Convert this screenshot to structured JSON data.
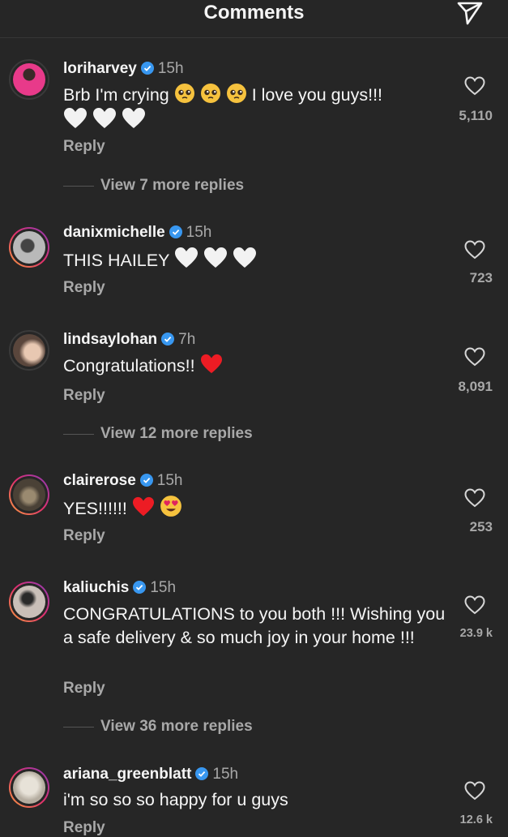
{
  "header": {
    "title": "Comments"
  },
  "comments": [
    {
      "username": "loriharvey",
      "time": "15h",
      "text_before": "Brb I'm crying",
      "text_after": "I love you guys!!!",
      "likes": "5,110",
      "reply": "Reply",
      "view_more": "View 7 more replies"
    },
    {
      "username": "danixmichelle",
      "time": "15h",
      "text": "THIS HAILEY",
      "likes": "723",
      "reply": "Reply"
    },
    {
      "username": "lindsaylohan",
      "time": "7h",
      "text": "Congratulations!!",
      "likes": "8,091",
      "reply": "Reply",
      "view_more": "View 12 more replies"
    },
    {
      "username": "clairerose",
      "time": "15h",
      "text": "YES!!!!!!",
      "likes": "253",
      "reply": "Reply"
    },
    {
      "username": "kaliuchis",
      "time": "15h",
      "text": "CONGRATULATIONS to you both !!! Wishing you a safe delivery & so much joy in your home !!!",
      "likes": "23.9 k",
      "reply": "Reply",
      "view_more": "View 36 more replies"
    },
    {
      "username": "ariana_greenblatt",
      "time": "15h",
      "text": "i'm so so so happy for u guys",
      "likes": "12.6 k",
      "reply": "Reply"
    }
  ],
  "icons": {
    "send": "send-icon",
    "heart": "heart-outline-icon",
    "verified": "verified-badge-icon"
  },
  "colors": {
    "background": "#262626",
    "text": "#f5f5f5",
    "secondary": "#a8a8a8",
    "verified": "#3897f0",
    "red_heart": "#ed1c24"
  }
}
